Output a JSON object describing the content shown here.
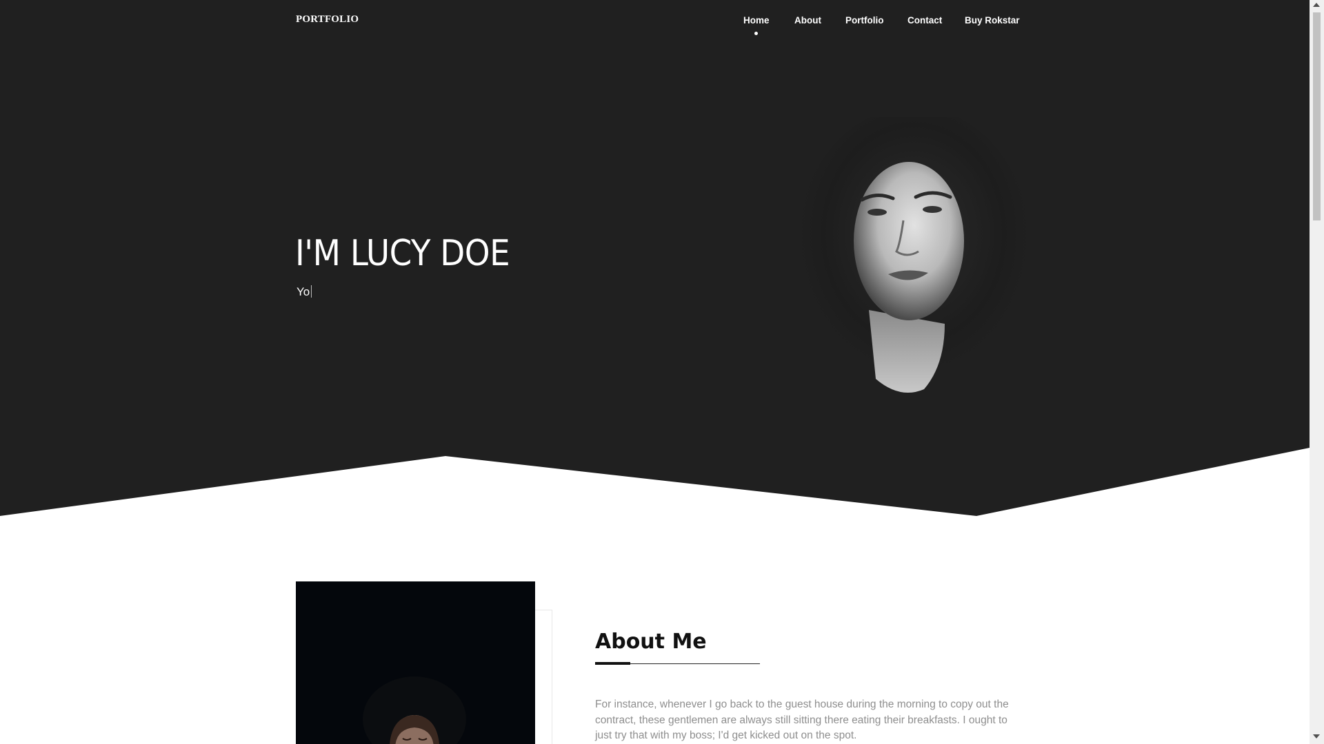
{
  "colors": {
    "hero_background": "#202020",
    "page_background": "#ffffff",
    "text_light": "#ffffff",
    "text_dark": "#111111",
    "text_muted": "#8e8e8e"
  },
  "navbar": {
    "brand": "PORTFOLIO",
    "items": [
      {
        "label": "Home",
        "active": true
      },
      {
        "label": "About",
        "active": false
      },
      {
        "label": "Portfolio",
        "active": false
      },
      {
        "label": "Contact",
        "active": false
      },
      {
        "label": "Buy Rokstar",
        "active": false
      }
    ]
  },
  "hero": {
    "title": "I'M LUCY DOE",
    "typed_text": "Yo",
    "portrait_icon": "woman-portrait-photo"
  },
  "about": {
    "title": "About Me",
    "photo_icon": "woman-in-hat-photo",
    "text": "For instance, whenever I go back to the guest house during the morning to copy out the contract, these gentlemen are always still sitting there eating their breakfasts. I ought to just try that with my boss; I'd get kicked out on the spot."
  }
}
